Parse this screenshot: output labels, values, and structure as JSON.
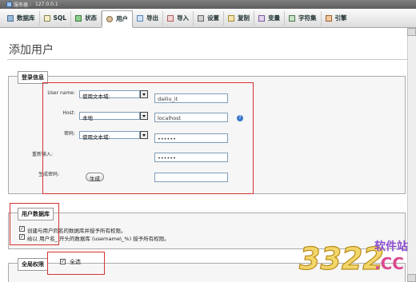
{
  "server": {
    "label": "服务器",
    "host": "127.0.0.1"
  },
  "tabs": [
    {
      "label": "数据库",
      "icon": "database-icon"
    },
    {
      "label": "SQL",
      "icon": "sql-icon"
    },
    {
      "label": "状态",
      "icon": "status-icon"
    },
    {
      "label": "用户",
      "icon": "users-icon",
      "active": true
    },
    {
      "label": "导出",
      "icon": "export-icon"
    },
    {
      "label": "导入",
      "icon": "import-icon"
    },
    {
      "label": "设置",
      "icon": "settings-icon"
    },
    {
      "label": "复制",
      "icon": "replication-icon"
    },
    {
      "label": "变量",
      "icon": "variables-icon"
    },
    {
      "label": "字符集",
      "icon": "charset-icon"
    },
    {
      "label": "引擎",
      "icon": "engines-icon"
    }
  ],
  "page_title": "添加用户",
  "login": {
    "legend": "登录信息",
    "username": {
      "label": "User name:",
      "mode": "使用文本域:",
      "value": "dailiu_it"
    },
    "host": {
      "label": "Host:",
      "mode": "本地",
      "value": "localhost"
    },
    "password": {
      "label": "密码:",
      "mode": "使用文本域:",
      "value": "••••••"
    },
    "retype": {
      "label": "重新输入:",
      "value": "••••••"
    },
    "generate": {
      "label": "生成密码:",
      "button": "生成"
    }
  },
  "user_db": {
    "legend": "用户数据库",
    "option1": "创建与用户同名的数据库并授予所有权限。",
    "option2": "给以 用户名_ 开头的数据库 (username\\_%) 授予所有权限。"
  },
  "global": {
    "legend": "全局权限",
    "select_all": "全选"
  },
  "watermark": {
    "brand": "3322",
    "sub": "软件站",
    "tld": ".CC"
  },
  "colors": {
    "highlight": "#d4332e",
    "accent": "#3a78c8"
  }
}
